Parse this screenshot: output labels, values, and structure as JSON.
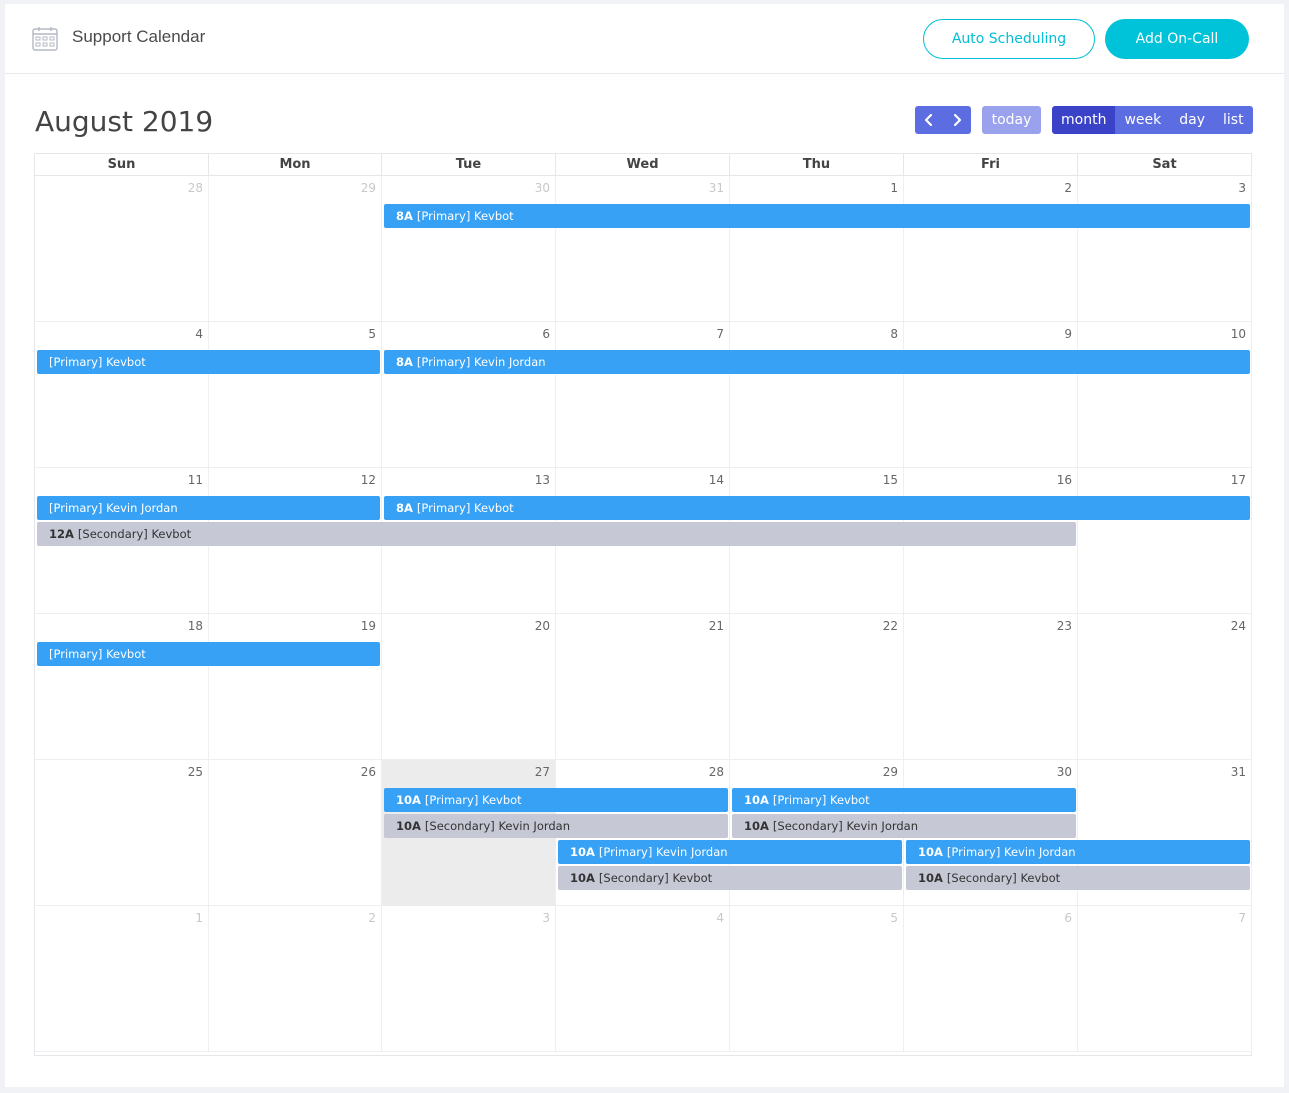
{
  "header": {
    "title": "Support Calendar",
    "auto_scheduling": "Auto Scheduling",
    "add_oncall": "Add On-Call"
  },
  "toolbar": {
    "month_title": "August 2019",
    "today": "today",
    "views": [
      "month",
      "week",
      "day",
      "list"
    ],
    "active_view": "month"
  },
  "colors": {
    "accent": "#00c2d8",
    "primary_event": "#36a1f5",
    "secondary_event": "#c6c8d6",
    "nav": "#5b6de0",
    "nav_active": "#3a42c8"
  },
  "days_of_week": [
    "Sun",
    "Mon",
    "Tue",
    "Wed",
    "Thu",
    "Fri",
    "Sat"
  ],
  "weeks": [
    {
      "days": [
        {
          "n": "28",
          "other": true
        },
        {
          "n": "29",
          "other": true
        },
        {
          "n": "30",
          "other": true
        },
        {
          "n": "31",
          "other": true
        },
        {
          "n": "1"
        },
        {
          "n": "2"
        },
        {
          "n": "3"
        }
      ],
      "events": [
        {
          "time": "8A",
          "text": "[Primary] Kevbot",
          "type": "primary",
          "start": 2,
          "end": 7,
          "row": 0
        }
      ]
    },
    {
      "days": [
        {
          "n": "4"
        },
        {
          "n": "5"
        },
        {
          "n": "6"
        },
        {
          "n": "7"
        },
        {
          "n": "8"
        },
        {
          "n": "9"
        },
        {
          "n": "10"
        }
      ],
      "events": [
        {
          "time": "",
          "text": "[Primary] Kevbot",
          "type": "primary",
          "start": 0,
          "end": 2,
          "row": 0
        },
        {
          "time": "8A",
          "text": "[Primary] Kevin Jordan",
          "type": "primary",
          "start": 2,
          "end": 7,
          "row": 0
        }
      ]
    },
    {
      "days": [
        {
          "n": "11"
        },
        {
          "n": "12"
        },
        {
          "n": "13"
        },
        {
          "n": "14"
        },
        {
          "n": "15"
        },
        {
          "n": "16"
        },
        {
          "n": "17"
        }
      ],
      "events": [
        {
          "time": "",
          "text": "[Primary] Kevin Jordan",
          "type": "primary",
          "start": 0,
          "end": 2,
          "row": 0
        },
        {
          "time": "8A",
          "text": "[Primary] Kevbot",
          "type": "primary",
          "start": 2,
          "end": 7,
          "row": 0
        },
        {
          "time": "12A",
          "text": "[Secondary] Kevbot",
          "type": "secondary",
          "start": 0,
          "end": 6,
          "row": 1
        }
      ]
    },
    {
      "days": [
        {
          "n": "18"
        },
        {
          "n": "19"
        },
        {
          "n": "20"
        },
        {
          "n": "21"
        },
        {
          "n": "22"
        },
        {
          "n": "23"
        },
        {
          "n": "24"
        }
      ],
      "events": [
        {
          "time": "",
          "text": "[Primary] Kevbot",
          "type": "primary",
          "start": 0,
          "end": 2,
          "row": 0
        }
      ]
    },
    {
      "days": [
        {
          "n": "25"
        },
        {
          "n": "26"
        },
        {
          "n": "27",
          "today": true
        },
        {
          "n": "28"
        },
        {
          "n": "29"
        },
        {
          "n": "30"
        },
        {
          "n": "31"
        }
      ],
      "events": [
        {
          "time": "10A",
          "text": "[Primary] Kevbot",
          "type": "primary",
          "start": 2,
          "end": 4,
          "row": 0
        },
        {
          "time": "10A",
          "text": "[Primary] Kevbot",
          "type": "primary",
          "start": 4,
          "end": 6,
          "row": 0
        },
        {
          "time": "10A",
          "text": "[Secondary] Kevin Jordan",
          "type": "secondary",
          "start": 2,
          "end": 4,
          "row": 1
        },
        {
          "time": "10A",
          "text": "[Secondary] Kevin Jordan",
          "type": "secondary",
          "start": 4,
          "end": 6,
          "row": 1
        },
        {
          "time": "10A",
          "text": "[Primary] Kevin Jordan",
          "type": "primary",
          "start": 3,
          "end": 5,
          "row": 2
        },
        {
          "time": "10A",
          "text": "[Primary] Kevin Jordan",
          "type": "primary",
          "start": 5,
          "end": 7,
          "row": 2
        },
        {
          "time": "10A",
          "text": "[Secondary] Kevbot",
          "type": "secondary",
          "start": 3,
          "end": 5,
          "row": 3
        },
        {
          "time": "10A",
          "text": "[Secondary] Kevbot",
          "type": "secondary",
          "start": 5,
          "end": 7,
          "row": 3
        }
      ]
    },
    {
      "days": [
        {
          "n": "1",
          "other": true
        },
        {
          "n": "2",
          "other": true
        },
        {
          "n": "3",
          "other": true
        },
        {
          "n": "4",
          "other": true
        },
        {
          "n": "5",
          "other": true
        },
        {
          "n": "6",
          "other": true
        },
        {
          "n": "7",
          "other": true
        }
      ],
      "events": []
    }
  ]
}
